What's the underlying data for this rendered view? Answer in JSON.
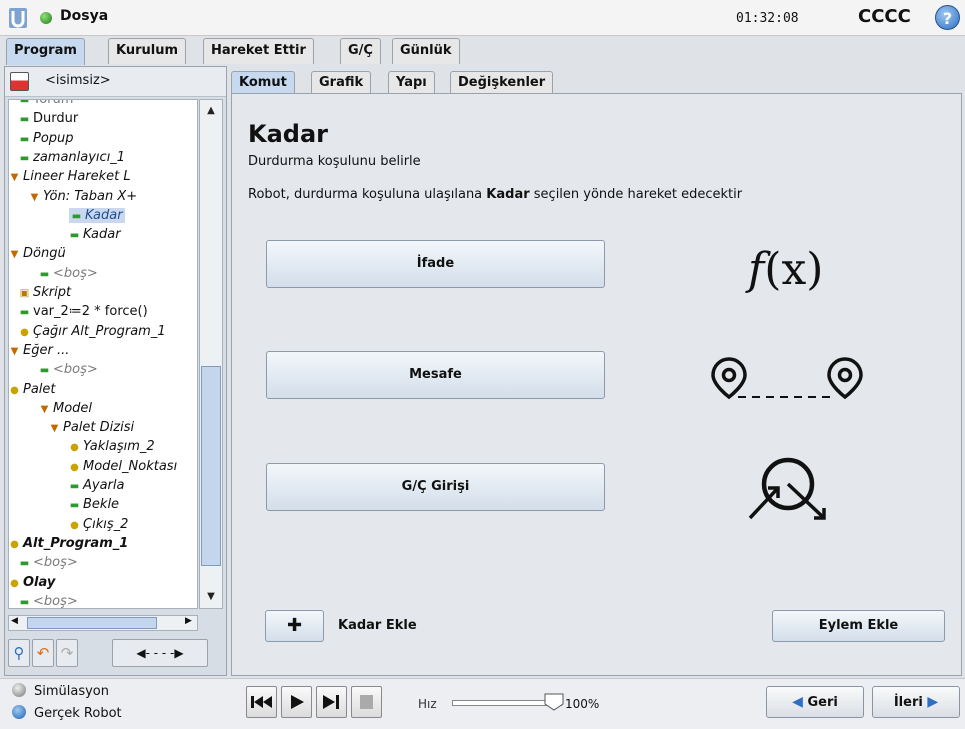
{
  "header": {
    "file_label": "Dosya",
    "clock": "01:32:08",
    "robot_name": "CCCC",
    "help_label": "?"
  },
  "main_tabs": [
    {
      "label": "Program",
      "active": true
    },
    {
      "label": "Kurulum",
      "active": false
    },
    {
      "label": "Hareket Ettir",
      "active": false
    },
    {
      "label": "G/Ç",
      "active": false
    },
    {
      "label": "Günlük",
      "active": false
    }
  ],
  "left": {
    "program_name": "<isimsiz>",
    "tree": [
      {
        "label": "Yorum",
        "style": "gray",
        "glyph": "line"
      },
      {
        "label": "Durdur",
        "style": "",
        "glyph": "line"
      },
      {
        "label": "Popup",
        "style": "it",
        "glyph": "line"
      },
      {
        "label": "zamanlayıcı_1",
        "style": "it",
        "glyph": "line"
      },
      {
        "label": "Lineer Hareket L",
        "style": "it",
        "glyph": "tri"
      },
      {
        "label": "Yön: Taban X+",
        "style": "it",
        "glyph": "tri"
      },
      {
        "label": "Kadar",
        "style": "it sel",
        "glyph": "line"
      },
      {
        "label": "Kadar",
        "style": "it",
        "glyph": "line"
      },
      {
        "label": "Döngü",
        "style": "it",
        "glyph": "tri"
      },
      {
        "label": "<boş>",
        "style": "it gray",
        "glyph": "line"
      },
      {
        "label": "Skript",
        "style": "it",
        "glyph": "sq"
      },
      {
        "label": "var_2≔2 * force()",
        "style": "",
        "glyph": "line"
      },
      {
        "label": "Çağır Alt_Program_1",
        "style": "it",
        "glyph": "dot"
      },
      {
        "label": "Eğer ...",
        "style": "it",
        "glyph": "tri"
      },
      {
        "label": "<boş>",
        "style": "it gray",
        "glyph": "line"
      },
      {
        "label": "Palet",
        "style": "it",
        "glyph": "dot"
      },
      {
        "label": "Model",
        "style": "it",
        "glyph": "tri"
      },
      {
        "label": "Palet Dizisi",
        "style": "it",
        "glyph": "tri"
      },
      {
        "label": "Yaklaşım_2",
        "style": "it",
        "glyph": "dot"
      },
      {
        "label": "Model_Noktası",
        "style": "it",
        "glyph": "dot"
      },
      {
        "label": "Ayarla",
        "style": "it",
        "glyph": "line"
      },
      {
        "label": "Bekle",
        "style": "it",
        "glyph": "line"
      },
      {
        "label": "Çıkış_2",
        "style": "it",
        "glyph": "dot"
      },
      {
        "label": "Alt_Program_1",
        "style": "bi",
        "glyph": "dot"
      },
      {
        "label": "<boş>",
        "style": "it gray",
        "glyph": "line"
      },
      {
        "label": "Olay",
        "style": "bi",
        "glyph": "dot"
      },
      {
        "label": "<boş>",
        "style": "it gray",
        "glyph": "line"
      }
    ]
  },
  "sub_tabs": [
    {
      "label": "Komut",
      "active": true
    },
    {
      "label": "Grafik",
      "active": false
    },
    {
      "label": "Yapı",
      "active": false
    },
    {
      "label": "Değişkenler",
      "active": false
    }
  ],
  "command": {
    "title": "Kadar",
    "subtitle": "Durdurma koşulunu belirle",
    "desc_before": "Robot, durdurma koşuluna ulaşılana ",
    "desc_bold": "Kadar",
    "desc_after": " seçilen yönde hareket edecektir",
    "buttons": [
      "İfade",
      "Mesafe",
      "G/Ç Girişi"
    ],
    "fx_f": "f",
    "fx_rest": "(x)",
    "add_until": "Kadar Ekle",
    "add_action": "Eylem Ekle"
  },
  "bottom": {
    "sim": "Simülasyon",
    "real": "Gerçek Robot",
    "speed_label": "Hız",
    "speed_value": "100%",
    "speed_fraction": 1.0,
    "back": "Geri",
    "next": "İleri"
  }
}
